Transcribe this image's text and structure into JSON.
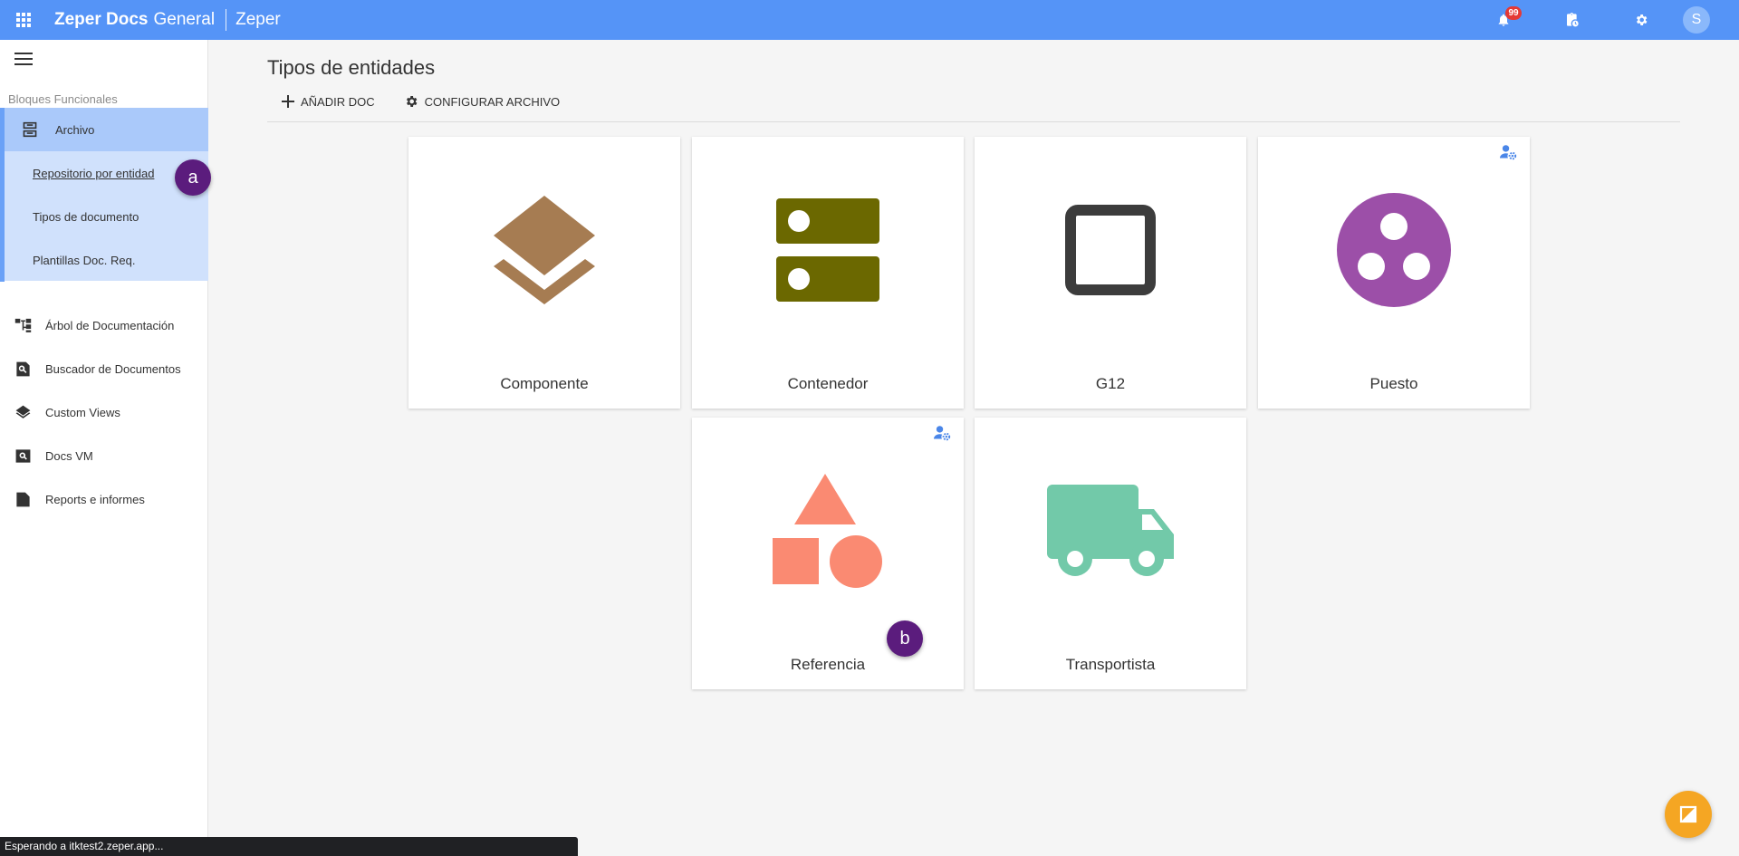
{
  "header": {
    "brand": "Zeper Docs",
    "brand_sub": "General",
    "org": "Zeper",
    "notifications_count": "99",
    "avatar_initial": "S",
    "color": "#5594f7"
  },
  "sidebar": {
    "section_label": "Bloques Funcionales",
    "group": {
      "label": "Archivo",
      "children": [
        {
          "label": "Repositorio por entidad"
        },
        {
          "label": "Tipos de documento"
        },
        {
          "label": "Plantillas Doc. Req."
        }
      ]
    },
    "items": [
      {
        "label": "Árbol de Documentación"
      },
      {
        "label": "Buscador de Documentos"
      },
      {
        "label": "Custom Views"
      },
      {
        "label": "Docs VM"
      },
      {
        "label": "Reports e informes"
      }
    ]
  },
  "main": {
    "title": "Tipos de entidades",
    "toolbar": {
      "add_label": "AÑADIR DOC",
      "config_label": "CONFIGURAR ARCHIVO"
    },
    "cards": [
      {
        "label": "Componente",
        "icon": "layers-icon",
        "color": "#a67c52"
      },
      {
        "label": "Contenedor",
        "icon": "storage-icon",
        "color": "#6b6800"
      },
      {
        "label": "G12",
        "icon": "square-outline-icon",
        "color": "#3c3c3c"
      },
      {
        "label": "Puesto",
        "icon": "workspaces-icon",
        "color": "#9c4fa8"
      },
      {
        "label": "Referencia",
        "icon": "category-shapes-icon",
        "color": "#fa8a72"
      },
      {
        "label": "Transportista",
        "icon": "truck-icon",
        "color": "#72c9a9"
      }
    ]
  },
  "markers": {
    "a": "a",
    "b": "b"
  },
  "statusbar": {
    "text": "Esperando a itktest2.zeper.app..."
  },
  "colors": {
    "fab": "#f5a623",
    "sidebar_active": "#aac9fa",
    "sidebar_group": "#d0e1fc"
  }
}
